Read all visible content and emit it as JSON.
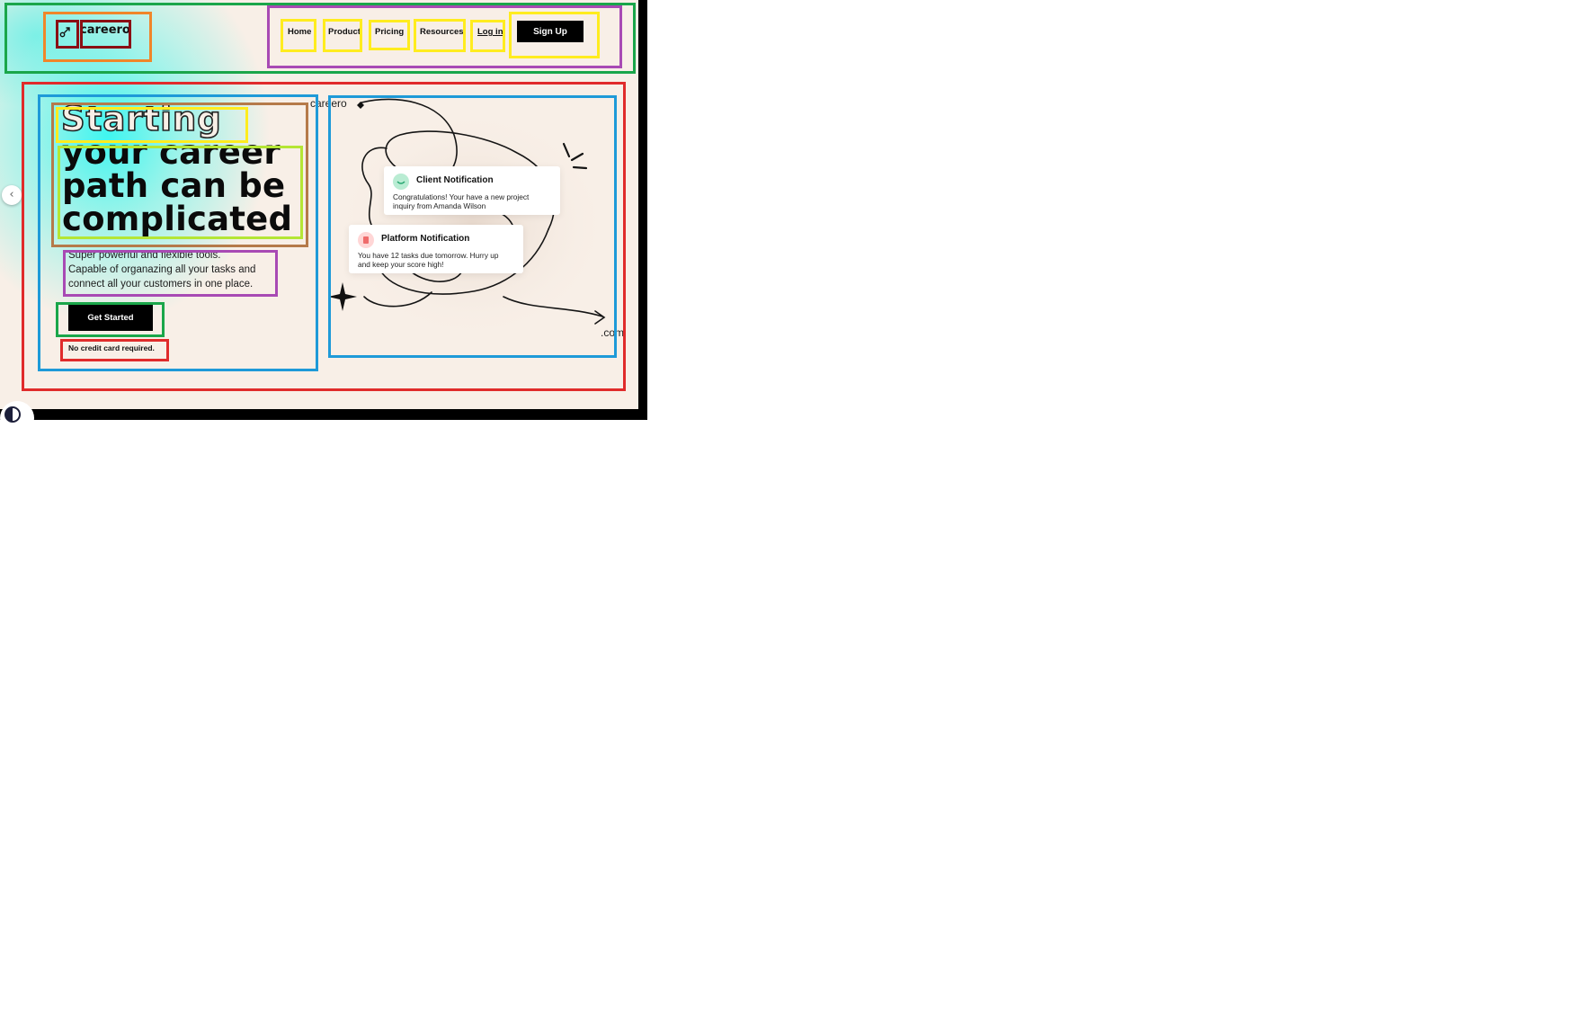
{
  "header": {
    "logo_text": "careero",
    "logo_icon": "logo-arrow-icon",
    "nav": {
      "home": "Home",
      "product": "Product",
      "pricing": "Pricing",
      "resources": "Resources",
      "login": "Log in"
    },
    "signup_label": "Sign Up"
  },
  "hero": {
    "headline_outline": "Starting",
    "headline_lines": [
      "your career",
      "path can be",
      "complicated"
    ],
    "subtitle_lines": [
      "Super powerful and flexible tools.",
      "Capable of organazing all your tasks and",
      "connect all your customers in one place."
    ],
    "cta_label": "Get Started",
    "note": "No credit card required."
  },
  "illustration": {
    "brand_tag": "careero",
    "domain_suffix": ".com",
    "cards": [
      {
        "title": "Client Notification",
        "body_lines": [
          "Congratulations! Your have a new project",
          "inquiry from Amanda Wilson"
        ],
        "badge_color": "#b9ecd3"
      },
      {
        "title": "Platform Notification",
        "body_lines": [
          "You have 12 tasks due tomorrow. Hurry up",
          "and keep your score high!"
        ],
        "badge_color": "#ffd6d6"
      }
    ]
  },
  "colors": {
    "page_bg": "#f8efe7",
    "accent_glow": "#3ff5ef",
    "button_bg": "#000000"
  }
}
